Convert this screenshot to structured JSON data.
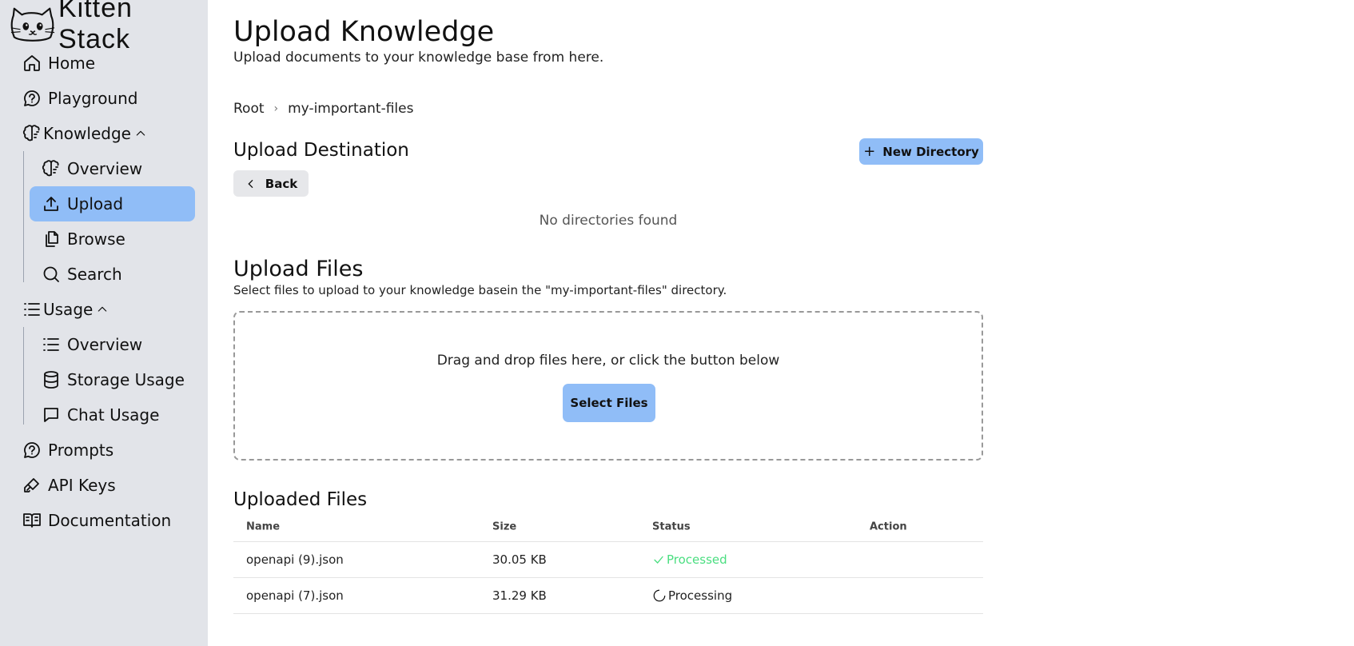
{
  "app": {
    "name": "Kitten Stack"
  },
  "sidebar": {
    "items": [
      {
        "label": "Home",
        "icon": "home-icon"
      },
      {
        "label": "Playground",
        "icon": "chat-bubble-icon"
      },
      {
        "label": "Knowledge",
        "icon": "brain-icon",
        "expanded": true,
        "children": [
          {
            "label": "Overview",
            "icon": "brain-icon"
          },
          {
            "label": "Upload",
            "icon": "upload-icon",
            "active": true
          },
          {
            "label": "Browse",
            "icon": "files-icon"
          },
          {
            "label": "Search",
            "icon": "search-icon"
          }
        ]
      },
      {
        "label": "Usage",
        "icon": "list-icon",
        "expanded": true,
        "children": [
          {
            "label": "Overview",
            "icon": "list-icon"
          },
          {
            "label": "Storage Usage",
            "icon": "database-icon"
          },
          {
            "label": "Chat Usage",
            "icon": "message-square-icon"
          }
        ]
      },
      {
        "label": "Prompts",
        "icon": "chat-bubble-icon"
      },
      {
        "label": "API Keys",
        "icon": "key-icon"
      },
      {
        "label": "Documentation",
        "icon": "book-icon"
      }
    ],
    "accent": "#90bdf7"
  },
  "page": {
    "title": "Upload Knowledge",
    "subtitle": "Upload documents to your knowledge base from here."
  },
  "breadcrumb": {
    "root": "Root",
    "current": "my-important-files"
  },
  "destination": {
    "heading": "Upload Destination",
    "new_directory_label": "New Directory",
    "back_label": "Back",
    "empty_text": "No directories found"
  },
  "upload": {
    "heading": "Upload Files",
    "description": "Select files to upload to your knowledge basein the \"my-important-files\" directory.",
    "drop_text": "Drag and drop files here, or click the button below",
    "select_label": "Select Files"
  },
  "uploaded": {
    "heading": "Uploaded Files",
    "columns": [
      "Name",
      "Size",
      "Status",
      "Action"
    ],
    "rows": [
      {
        "name": "openapi (9).json",
        "size": "30.05 KB",
        "status": "Processed",
        "status_color": "#4ade80"
      },
      {
        "name": "openapi (7).json",
        "size": "31.29 KB",
        "status": "Processing"
      }
    ]
  }
}
